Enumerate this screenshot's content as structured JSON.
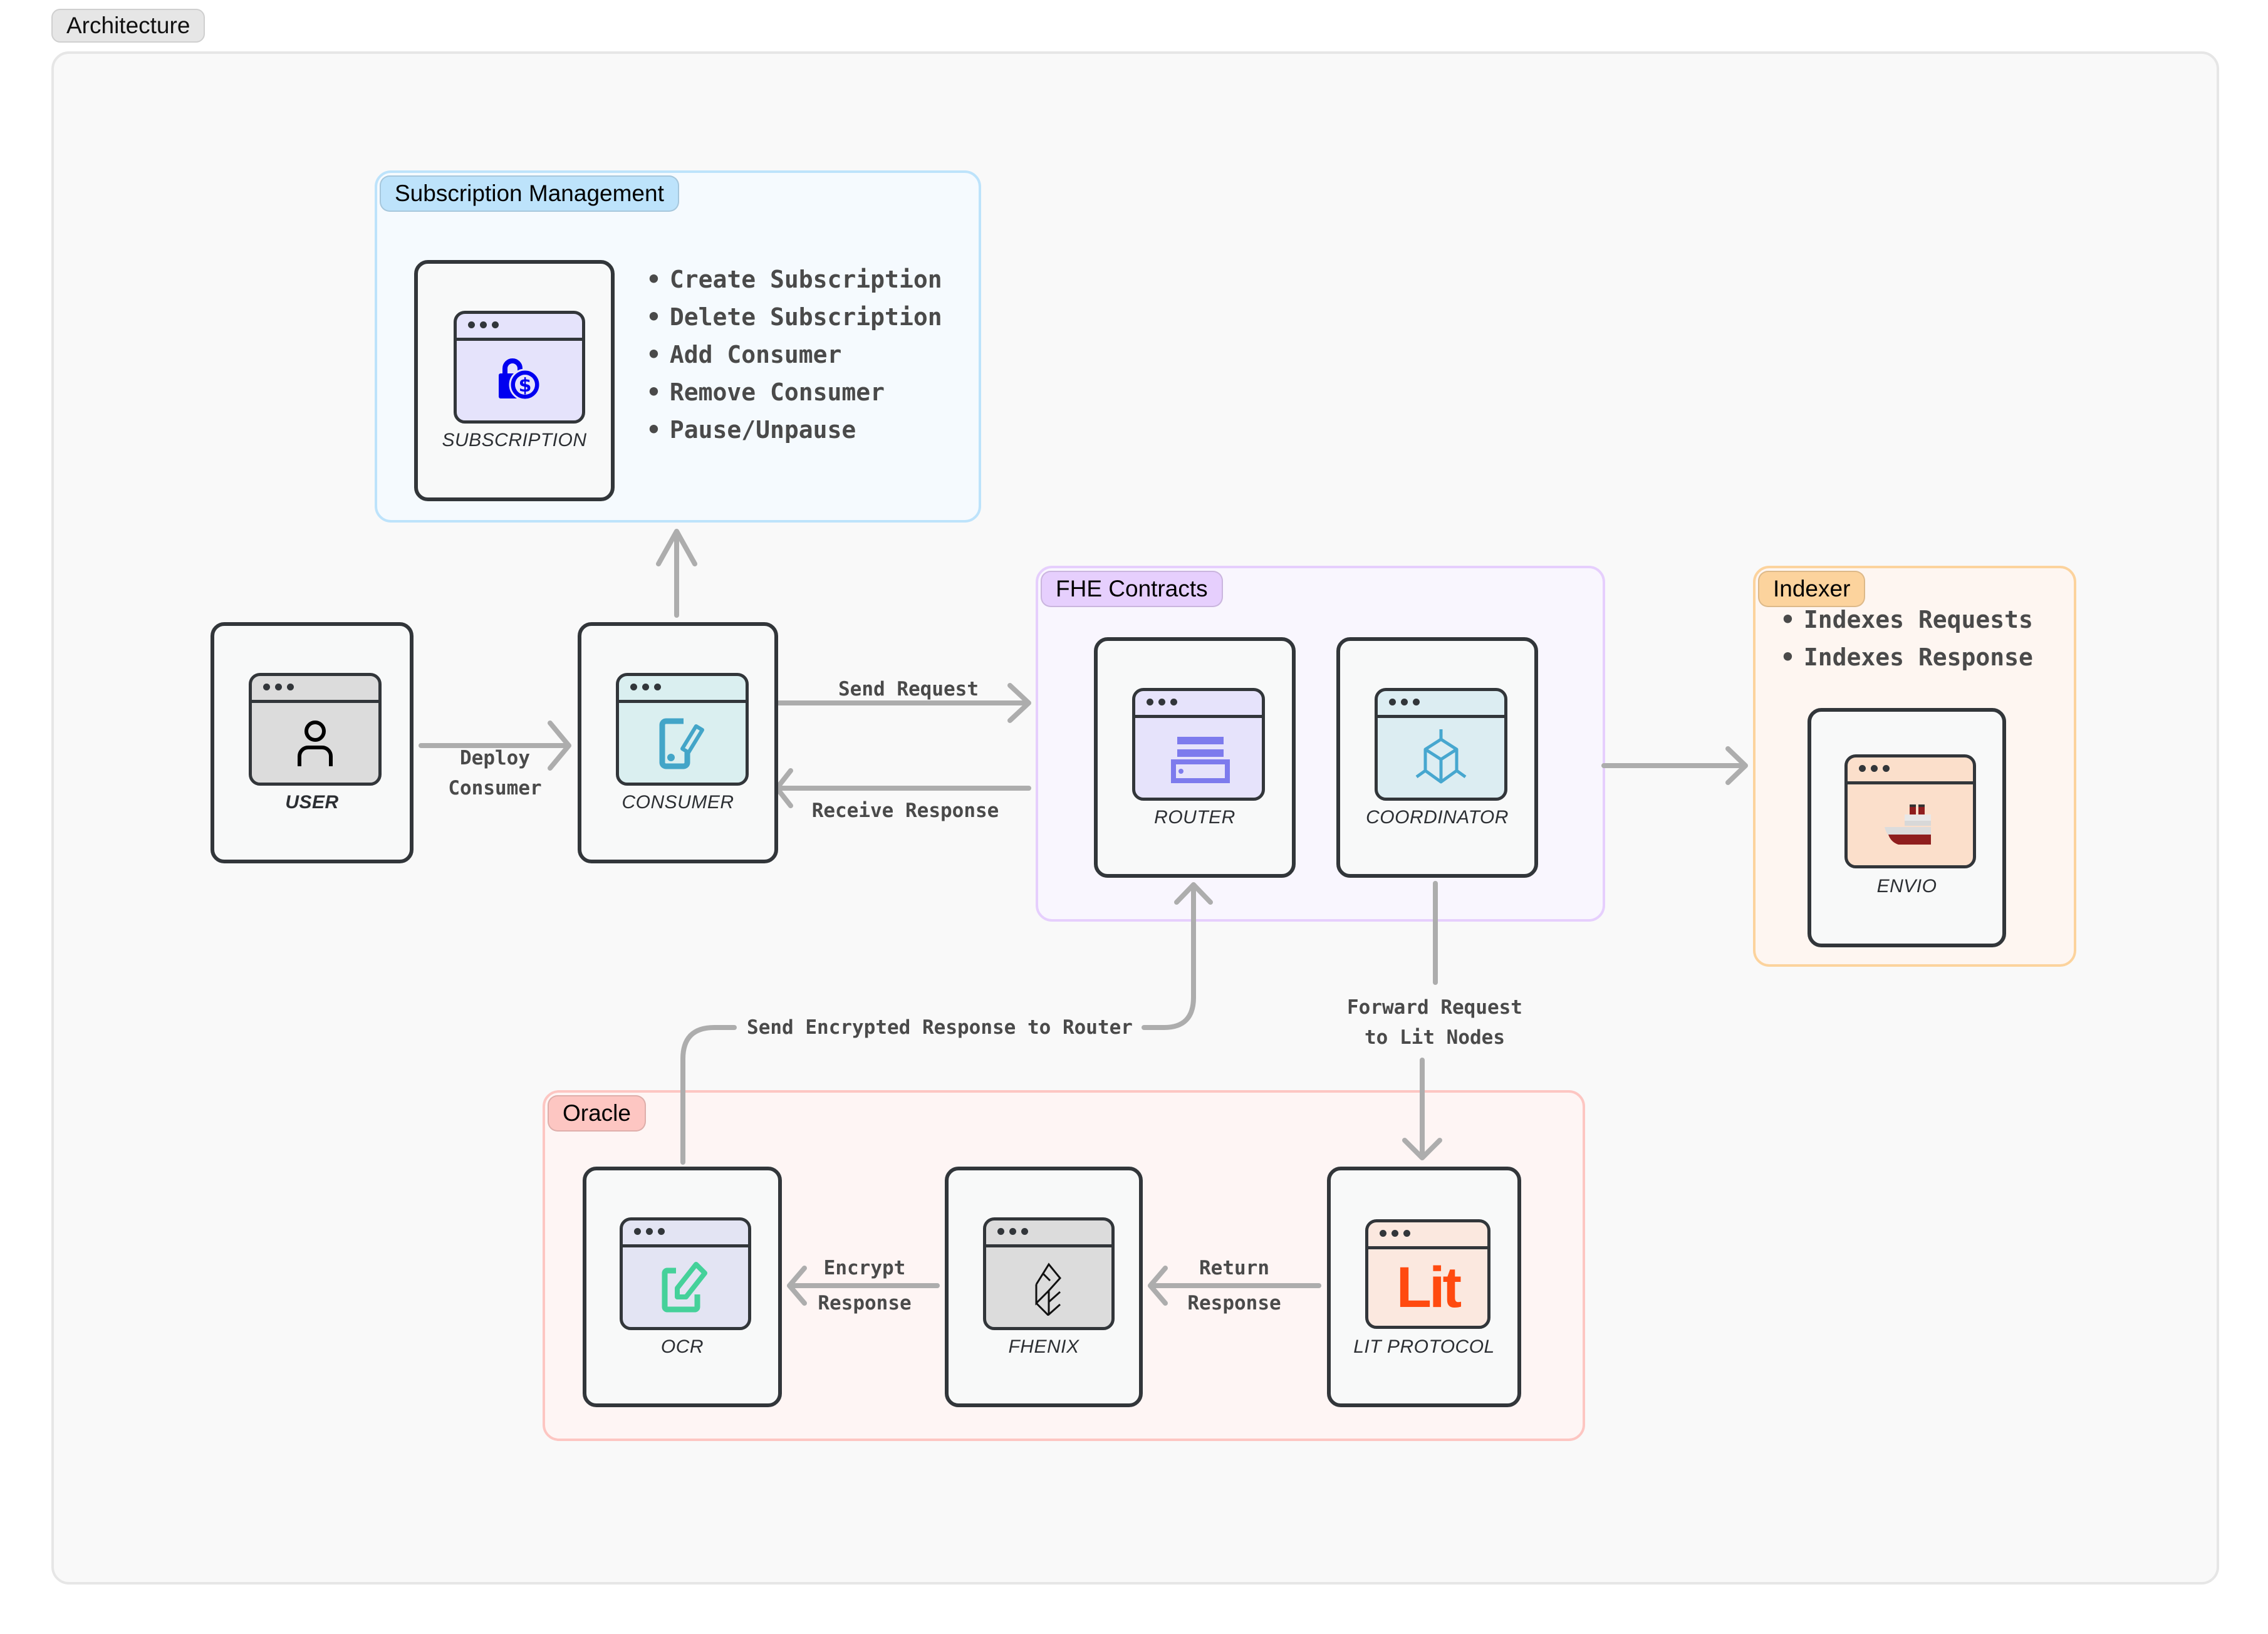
{
  "page": {
    "title": "Architecture"
  },
  "colors": {
    "subscription_group": "#bde3fb",
    "fhe_group": "#e6cffd",
    "indexer_group": "#fcd39d",
    "oracle_group": "#fdc6c2",
    "arrow": "#adadad",
    "card_border": "#32363a"
  },
  "groups": {
    "subscription": {
      "label": "Subscription Management",
      "features": [
        "Create Subscription",
        "Delete Subscription",
        "Add Consumer",
        "Remove Consumer",
        "Pause/Unpause"
      ]
    },
    "fhe": {
      "label": "FHE Contracts"
    },
    "indexer": {
      "label": "Indexer",
      "features": [
        "Indexes Requests",
        "Indexes Response"
      ]
    },
    "oracle": {
      "label": "Oracle"
    }
  },
  "nodes": {
    "subscription": {
      "label": "SUBSCRIPTION",
      "icon": "lock-dollar-icon"
    },
    "user": {
      "label": "USER",
      "icon": "user-icon"
    },
    "consumer": {
      "label": "CONSUMER",
      "icon": "edit-doc-icon"
    },
    "router": {
      "label": "ROUTER",
      "icon": "router-icon"
    },
    "coordinator": {
      "label": "COORDINATOR",
      "icon": "cube-network-icon"
    },
    "envio": {
      "label": "ENVIO",
      "icon": "ship-icon"
    },
    "ocr": {
      "label": "OCR",
      "icon": "edit-icon"
    },
    "fhenix": {
      "label": "FHENIX",
      "icon": "fhenix-logo-icon"
    },
    "lit": {
      "label": "LIT PROTOCOL",
      "icon": "lit-logo-icon",
      "logo_text": "Lit"
    }
  },
  "edges": {
    "deploy_consumer": [
      "Deploy",
      "Consumer"
    ],
    "send_request": "Send Request",
    "receive_response": "Receive Response",
    "send_encrypted": "Send Encrypted Response to Router",
    "forward_request": [
      "Forward Request",
      "to Lit Nodes"
    ],
    "encrypt_response": [
      "Encrypt",
      "Response"
    ],
    "return_response": [
      "Return",
      "Response"
    ]
  }
}
